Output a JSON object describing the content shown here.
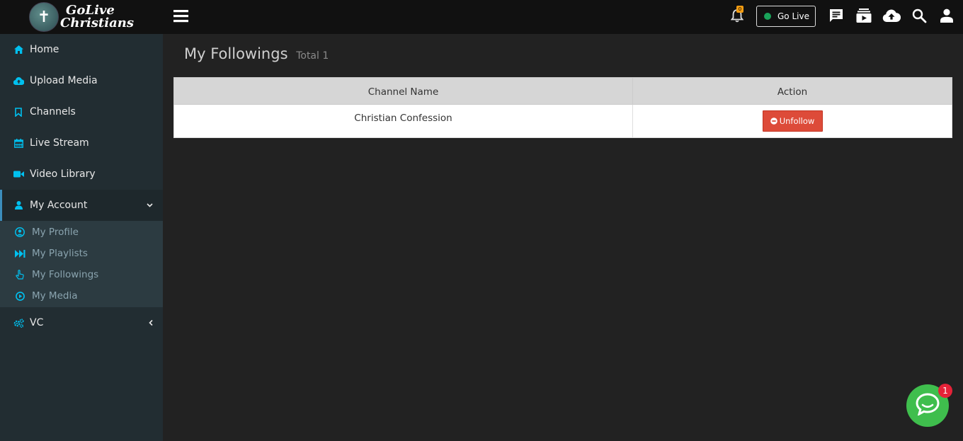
{
  "brand": {
    "logo_line1": "GoLive",
    "logo_line2": "Christians"
  },
  "sidebar": {
    "items": [
      {
        "label": "Home",
        "icon": "home-icon"
      },
      {
        "label": "Upload Media",
        "icon": "cloud-upload-icon"
      },
      {
        "label": "Channels",
        "icon": "bookmark-icon"
      },
      {
        "label": "Live Stream",
        "icon": "calendar-icon"
      },
      {
        "label": "Video Library",
        "icon": "video-camera-icon"
      },
      {
        "label": "My Account",
        "icon": "user-icon"
      },
      {
        "label": "VC",
        "icon": "cogs-icon"
      }
    ],
    "submenu": [
      {
        "label": "My Profile",
        "icon": "user-circle-icon"
      },
      {
        "label": "My Playlists",
        "icon": "fast-forward-icon"
      },
      {
        "label": "My Followings",
        "icon": "hand-pointer-icon"
      },
      {
        "label": "My Media",
        "icon": "play-circle-icon"
      }
    ]
  },
  "topbar": {
    "notification_count": "0",
    "go_live_label": "Go Live",
    "go_live_status_color": "#1aa35a"
  },
  "main": {
    "title": "My Followings",
    "subtitle": "Total 1",
    "table": {
      "headers": [
        "Channel Name",
        "Action"
      ],
      "rows": [
        {
          "channel": "Christian Confession",
          "action_label": "Unfollow"
        }
      ]
    }
  },
  "chat_widget": {
    "badge_count": "1"
  },
  "colors": {
    "sidebar_bg": "#222d32",
    "accent_blue": "#3c8dbc",
    "icon_cyan": "#00c0ef",
    "unfollow_red": "#dd4b39",
    "chat_green": "#3fbe4d"
  }
}
